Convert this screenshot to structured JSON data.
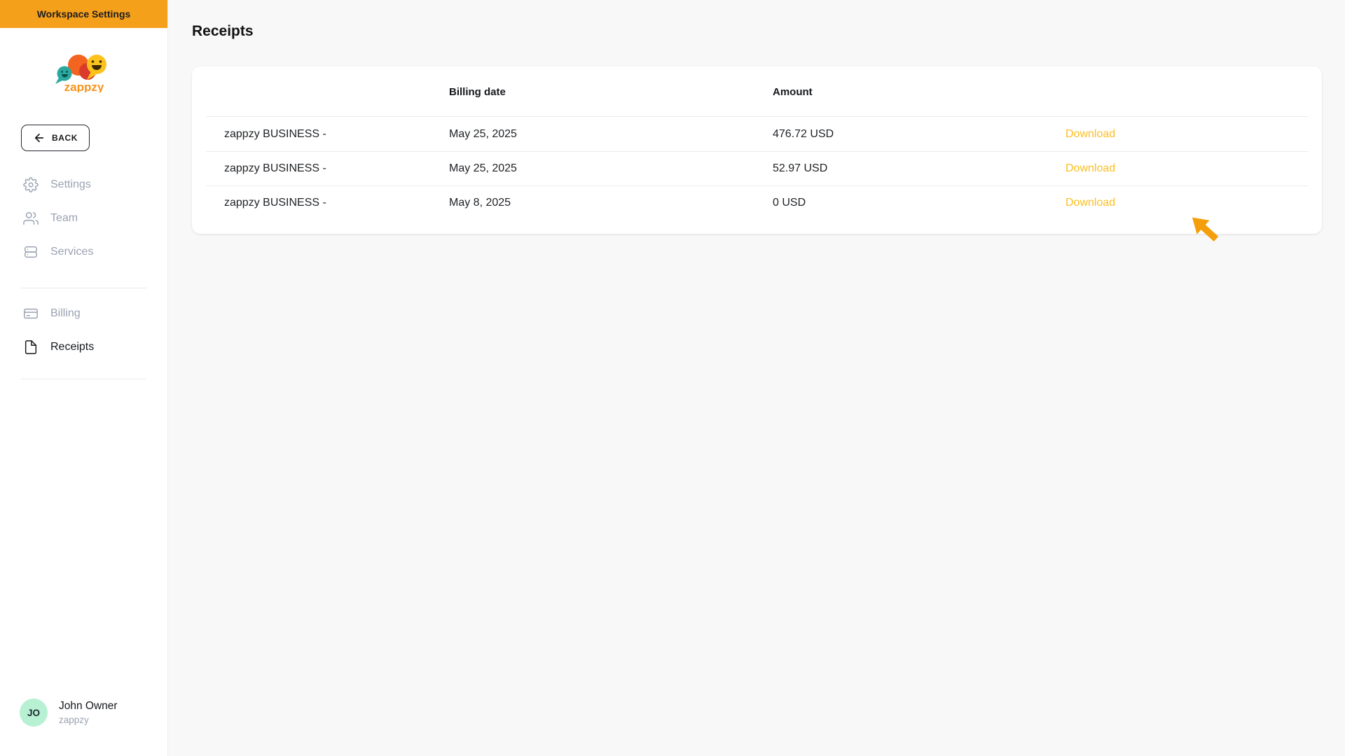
{
  "sidebar": {
    "banner": "Workspace Settings",
    "logo_text": "zappzy",
    "back_label": "BACK",
    "nav_primary": [
      {
        "label": "Settings",
        "icon": "gear-icon",
        "active": false
      },
      {
        "label": "Team",
        "icon": "users-icon",
        "active": false
      },
      {
        "label": "Services",
        "icon": "server-icon",
        "active": false
      }
    ],
    "nav_billing": [
      {
        "label": "Billing",
        "icon": "credit-card-icon",
        "active": false
      },
      {
        "label": "Receipts",
        "icon": "document-icon",
        "active": true
      }
    ],
    "user": {
      "initials": "JO",
      "name": "John Owner",
      "workspace": "zappzy"
    }
  },
  "main": {
    "title": "Receipts",
    "table": {
      "columns": [
        "",
        "Billing date",
        "Amount",
        ""
      ],
      "rows": [
        {
          "product": "zappzy BUSINESS -",
          "billing_date": "May 25, 2025",
          "amount": "476.72 USD",
          "action": "Download"
        },
        {
          "product": "zappzy BUSINESS -",
          "billing_date": "May 25, 2025",
          "amount": "52.97 USD",
          "action": "Download"
        },
        {
          "product": "zappzy BUSINESS -",
          "billing_date": "May 8, 2025",
          "amount": "0 USD",
          "action": "Download"
        }
      ]
    }
  },
  "colors": {
    "banner_orange": "#F5A01B",
    "download_link": "#FBBF24",
    "cursor_orange": "#F59E0B",
    "avatar_green": "#B7F0D2",
    "logo_orange": "#F6941D"
  }
}
